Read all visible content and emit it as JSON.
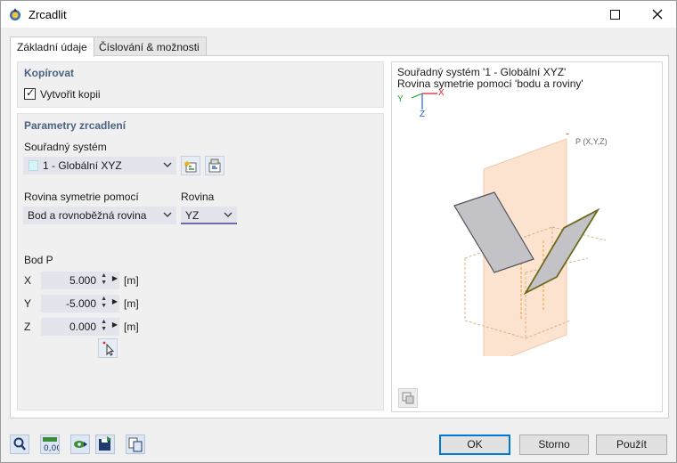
{
  "window": {
    "title": "Zrcadlit"
  },
  "tabs": [
    {
      "label": "Základní údaje",
      "active": true
    },
    {
      "label": "Číslování & možnosti",
      "active": false
    }
  ],
  "copy_section": {
    "title": "Kopírovat",
    "create_copy": {
      "label": "Vytvořit kopii",
      "checked": true
    }
  },
  "mirror_section": {
    "title": "Parametry zrcadlení",
    "coord_system": {
      "label": "Souřadný systém",
      "value": "1 - Globální XYZ"
    },
    "symmetry_plane": {
      "label": "Rovina symetrie pomocí",
      "value": "Bod a rovnoběžná rovina"
    },
    "plane": {
      "label": "Rovina",
      "value": "YZ"
    },
    "point": {
      "label": "Bod P",
      "x": {
        "label": "X",
        "value": "5.000",
        "unit": "[m]"
      },
      "y": {
        "label": "Y",
        "value": "-5.000",
        "unit": "[m]"
      },
      "z": {
        "label": "Z",
        "value": "0.000",
        "unit": "[m]"
      }
    }
  },
  "preview": {
    "line1": "Souřadný systém '1 - Globální XYZ'",
    "line2": "Rovina symetrie pomocí 'bodu a roviny'",
    "axis_x": "X",
    "axis_y": "Y",
    "axis_z": "Z",
    "point_label": "P (X,Y,Z)"
  },
  "buttons": {
    "ok": "OK",
    "cancel": "Storno",
    "apply": "Použít"
  },
  "colors": {
    "accent": "#0078d7",
    "section_head": "#4a6283",
    "plane": "#fbe3cf",
    "mirrored_part": "#c3c2c7"
  }
}
